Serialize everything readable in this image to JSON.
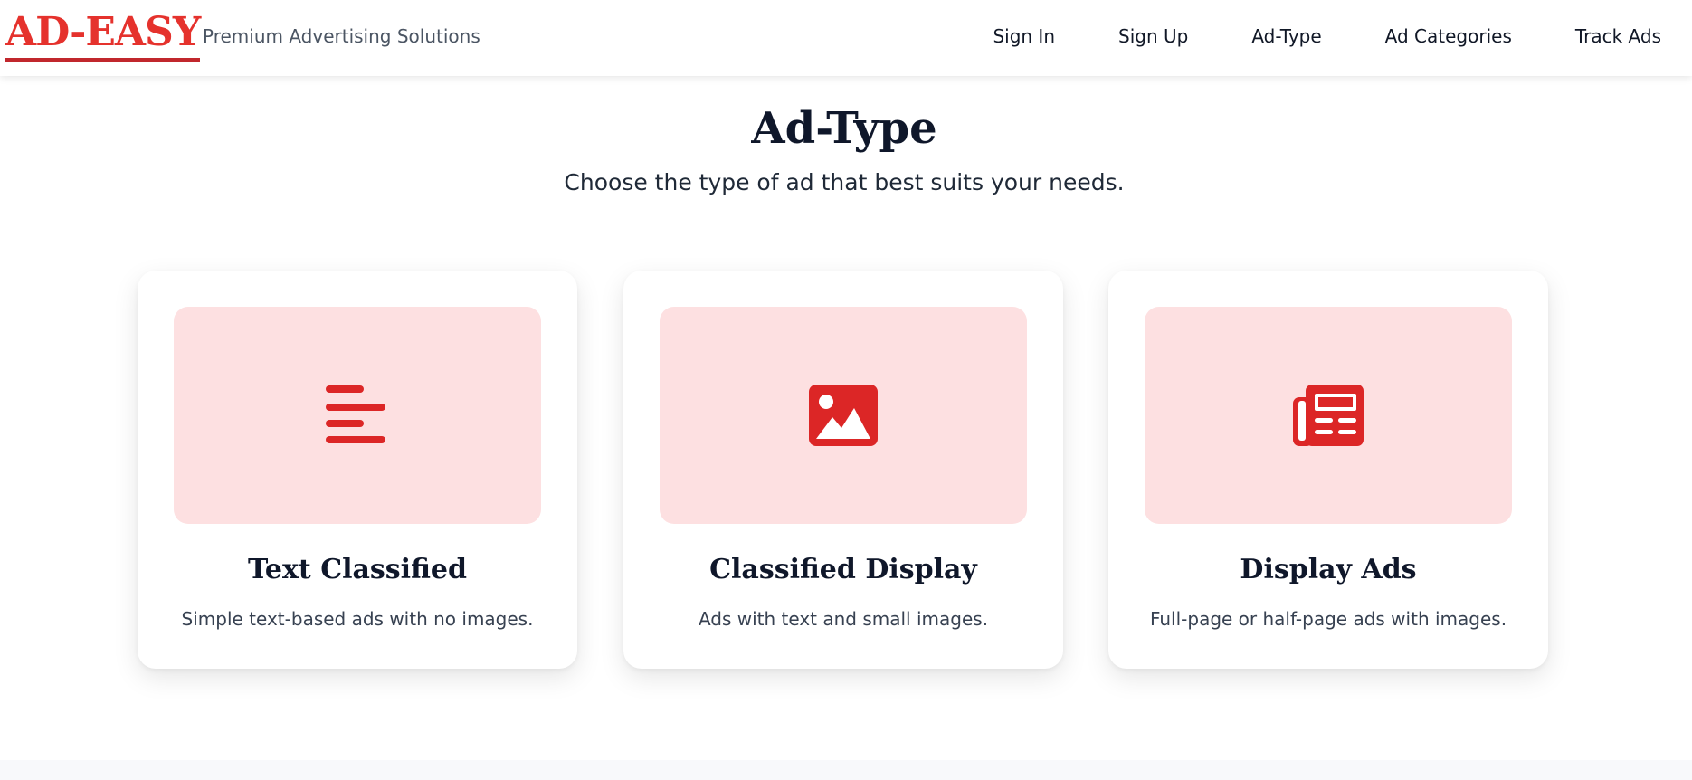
{
  "brand": {
    "logo": "AD-EASY",
    "tagline": "Premium Advertising Solutions",
    "accent_color": "#e5322d"
  },
  "nav": {
    "items": [
      {
        "label": "Sign In"
      },
      {
        "label": "Sign Up"
      },
      {
        "label": "Ad-Type"
      },
      {
        "label": "Ad Categories"
      },
      {
        "label": "Track Ads"
      }
    ]
  },
  "hero": {
    "title": "Ad-Type",
    "subtitle": "Choose the type of ad that best suits your needs."
  },
  "cards": [
    {
      "icon": "text-lines-icon",
      "title": "Text Classified",
      "description": "Simple text-based ads with no images."
    },
    {
      "icon": "image-icon",
      "title": "Classified Display",
      "description": "Ads with text and small images."
    },
    {
      "icon": "newspaper-icon",
      "title": "Display Ads",
      "description": "Full-page or half-page ads with images."
    }
  ],
  "colors": {
    "card_media_bg": "#fde0e1",
    "icon_color": "#dc2626",
    "heading_color": "#0f172a"
  }
}
